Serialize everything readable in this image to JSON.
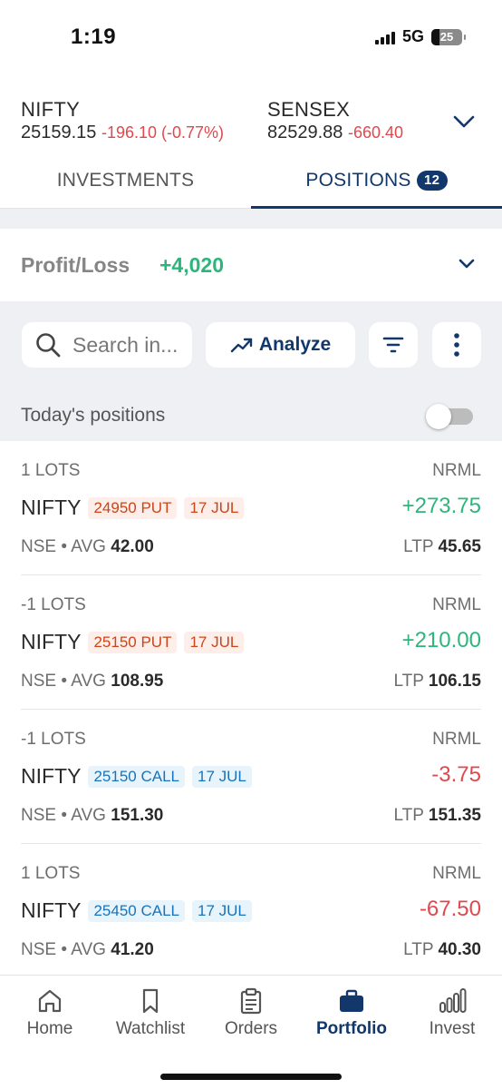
{
  "status_bar": {
    "time": "1:19",
    "network": "5G",
    "battery": "25"
  },
  "ticker": {
    "indices": [
      {
        "name": "NIFTY",
        "price": "25159.15",
        "change": "-196.10 (-0.77%)"
      },
      {
        "name": "SENSEX",
        "price": "82529.88",
        "change": "-660.40"
      }
    ],
    "chevron_icon": "chevron-down-icon"
  },
  "tabs": {
    "investments": "INVESTMENTS",
    "positions": "POSITIONS",
    "positions_count": "12"
  },
  "profit_loss": {
    "label": "Profit/Loss",
    "value": "+4,020"
  },
  "toolbar": {
    "search_placeholder": "Search in...",
    "analyze_label": "Analyze"
  },
  "todays_positions": {
    "label": "Today's positions",
    "toggle_on": false
  },
  "positions": [
    {
      "lots": "1 LOTS",
      "product": "NRML",
      "symbol": "NIFTY",
      "strike": "24950 PUT",
      "expiry": "17 JUL",
      "kind": "put",
      "pnl": "+273.75",
      "pnl_sign": "pos",
      "exchange": "NSE",
      "avg_label": "• AVG",
      "avg": "42.00",
      "ltp_label": "LTP",
      "ltp": "45.65"
    },
    {
      "lots": "-1 LOTS",
      "product": "NRML",
      "symbol": "NIFTY",
      "strike": "25150 PUT",
      "expiry": "17 JUL",
      "kind": "put",
      "pnl": "+210.00",
      "pnl_sign": "pos",
      "exchange": "NSE",
      "avg_label": "• AVG",
      "avg": "108.95",
      "ltp_label": "LTP",
      "ltp": "106.15"
    },
    {
      "lots": "-1 LOTS",
      "product": "NRML",
      "symbol": "NIFTY",
      "strike": "25150 CALL",
      "expiry": "17 JUL",
      "kind": "call",
      "pnl": "-3.75",
      "pnl_sign": "neg",
      "exchange": "NSE",
      "avg_label": "• AVG",
      "avg": "151.30",
      "ltp_label": "LTP",
      "ltp": "151.35"
    },
    {
      "lots": "1 LOTS",
      "product": "NRML",
      "symbol": "NIFTY",
      "strike": "25450 CALL",
      "expiry": "17 JUL",
      "kind": "call",
      "pnl": "-67.50",
      "pnl_sign": "neg",
      "exchange": "NSE",
      "avg_label": "• AVG",
      "avg": "41.20",
      "ltp_label": "LTP",
      "ltp": "40.30"
    }
  ],
  "bottom_nav": [
    {
      "label": "Home",
      "icon": "home-icon",
      "active": false
    },
    {
      "label": "Watchlist",
      "icon": "bookmark-icon",
      "active": false
    },
    {
      "label": "Orders",
      "icon": "clipboard-icon",
      "active": false
    },
    {
      "label": "Portfolio",
      "icon": "briefcase-icon",
      "active": true
    },
    {
      "label": "Invest",
      "icon": "bar-chart-icon",
      "active": false
    }
  ],
  "colors": {
    "brand": "#12386b",
    "profit": "#2db67c",
    "loss": "#e0484d",
    "put_tag": "#c9461a",
    "call_tag": "#1a73b8"
  }
}
